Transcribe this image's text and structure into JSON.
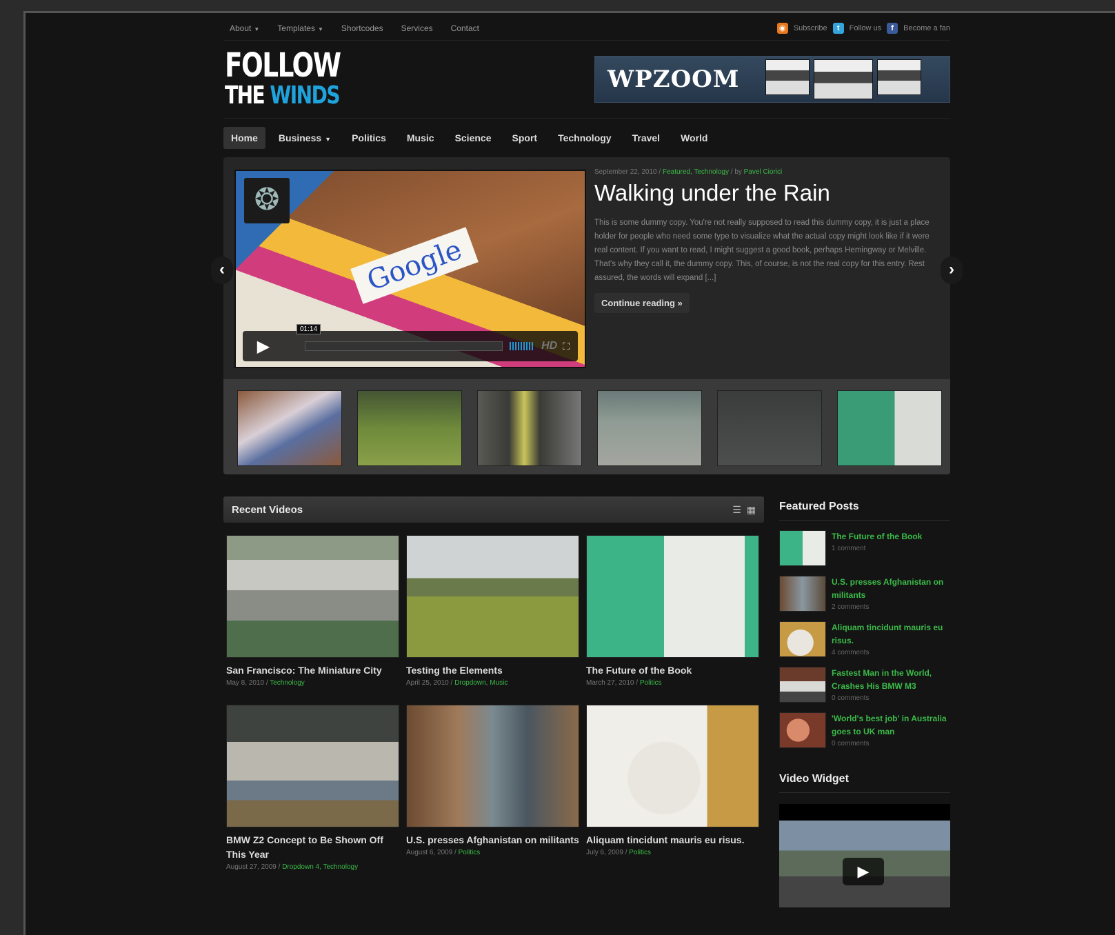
{
  "topnav": {
    "items": [
      "About",
      "Templates",
      "Shortcodes",
      "Services",
      "Contact"
    ],
    "with_caret": [
      true,
      true,
      false,
      false,
      false
    ]
  },
  "social": {
    "subscribe": "Subscribe",
    "follow": "Follow us",
    "fan": "Become a fan"
  },
  "logo": {
    "line1": "FOLLOW",
    "line2_a": "THE",
    "line2_b": "WINDS"
  },
  "banner": {
    "brand": "WPZOOM"
  },
  "mainnav": {
    "items": [
      "Home",
      "Business",
      "Politics",
      "Music",
      "Science",
      "Sport",
      "Technology",
      "Travel",
      "World"
    ],
    "active": "Home"
  },
  "slider": {
    "meta_date": "September 22, 2010",
    "meta_cats": "Featured, Technology",
    "meta_by": "by",
    "meta_author": "Pavel Ciorici",
    "title": "Walking under the Rain",
    "excerpt": "This is some dummy copy. You're not really supposed to read this dummy copy, it is just a place holder for people who need some type to visualize what the actual copy might look like if it were real content. If you want to read, I might suggest a good book, perhaps Hemingway or Melville. That's why they call it, the dummy copy. This, of course, is not the real copy for this entry. Rest assured, the words will expand [...]",
    "continue": "Continue reading »",
    "video_time": "01:14",
    "img_text": "Google",
    "hd": "HD"
  },
  "recent": {
    "title": "Recent Videos",
    "cards": [
      {
        "title": "San Francisco: The Miniature City",
        "date": "May 8, 2010",
        "cats": "Technology"
      },
      {
        "title": "Testing the Elements",
        "date": "April 25, 2010",
        "cats": "Dropdown, Music"
      },
      {
        "title": "The Future of the Book",
        "date": "March 27, 2010",
        "cats": "Politics"
      },
      {
        "title": "BMW Z2 Concept to Be Shown Off This Year",
        "date": "August 27, 2009",
        "cats": "Dropdown 4, Technology"
      },
      {
        "title": "U.S. presses Afghanistan on militants",
        "date": "August 6, 2009",
        "cats": "Politics"
      },
      {
        "title": "Aliquam tincidunt mauris eu risus.",
        "date": "July 6, 2009",
        "cats": "Politics"
      }
    ]
  },
  "featured": {
    "title": "Featured Posts",
    "posts": [
      {
        "title": "The Future of the Book",
        "comments": "1 comment"
      },
      {
        "title": "U.S. presses Afghanistan on militants",
        "comments": "2 comments"
      },
      {
        "title": "Aliquam tincidunt mauris eu risus.",
        "comments": "4 comments"
      },
      {
        "title": "Fastest Man in the World, Crashes His BMW M3",
        "comments": "0 comments"
      },
      {
        "title": "'World's best job' in Australia goes to UK man",
        "comments": "0 comments"
      }
    ]
  },
  "video_widget": {
    "title": "Video Widget"
  },
  "icons": {
    "rss": "rss-icon",
    "twitter": "twitter-icon",
    "facebook": "facebook-icon",
    "prev": "chevron-left-icon",
    "next": "chevron-right-icon",
    "list_view": "list-view-icon",
    "grid_view": "grid-view-icon"
  },
  "colors": {
    "accent_green": "#3bbb48",
    "logo_blue": "#1fa3dc",
    "background": "#141414"
  }
}
